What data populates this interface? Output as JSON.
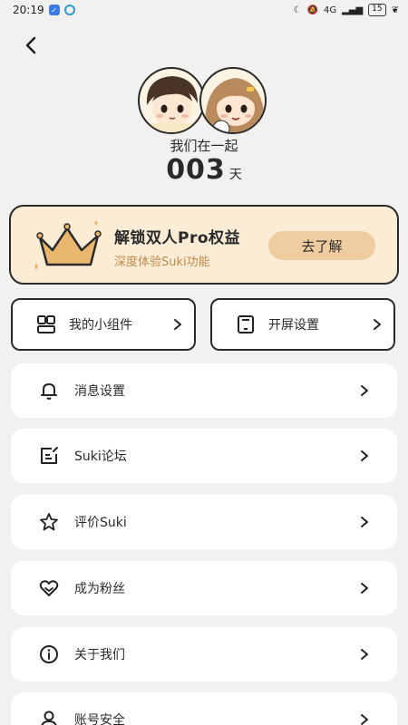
{
  "status_bar": {
    "time": "20:19",
    "battery": "15",
    "network": "4G"
  },
  "header": {
    "back_icon": "chevron-left-icon"
  },
  "couple": {
    "label": "我们在一起",
    "days": "003",
    "days_unit": "天"
  },
  "pro_banner": {
    "title": "解锁双人Pro权益",
    "subtitle": "深度体验Suki功能",
    "button": "去了解",
    "accent_color": "#fbecd6",
    "button_color": "#f0cda0"
  },
  "quick_cards": [
    {
      "label": "我的小组件",
      "icon": "widget-icon"
    },
    {
      "label": "开屏设置",
      "icon": "phone-screen-icon"
    }
  ],
  "menu": [
    {
      "label": "消息设置",
      "icon": "bell-icon"
    },
    {
      "label": "Suki论坛",
      "icon": "forum-edit-icon"
    },
    {
      "label": "评价Suki",
      "icon": "star-icon"
    },
    {
      "label": "成为粉丝",
      "icon": "heart-icon"
    },
    {
      "label": "关于我们",
      "icon": "info-icon"
    },
    {
      "label": "账号安全",
      "icon": "user-icon"
    }
  ]
}
